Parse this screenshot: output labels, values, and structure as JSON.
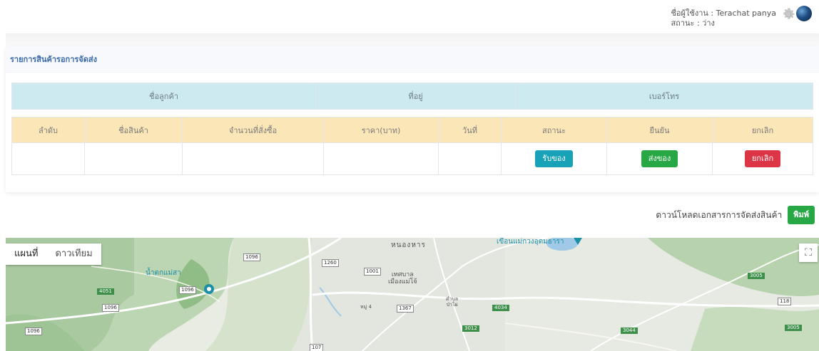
{
  "header": {
    "user_label": "ชื่อผู้ใช้งาน : Terachat panya",
    "status_label": "สถานะ : ว่าง",
    "icons": {
      "settings": "gear-icon",
      "globe": "globe-icon"
    }
  },
  "card": {
    "title": "รายการสินค้ารอการจัดส่ง",
    "customer_table": {
      "headers": [
        "ชื่อลูกค้า",
        "ที่อยู่",
        "เบอร์โทร"
      ]
    },
    "orders_table": {
      "headers": [
        "ลำดับ",
        "ชื่อสินค้า",
        "จำนวนที่สั่งซื้อ",
        "ราคา(บาท)",
        "วันที่",
        "สถานะ",
        "ยืนยัน",
        "ยกเลิก"
      ],
      "row": {
        "receive_button": "รับของ",
        "ship_button": "ส่งของ",
        "cancel_button": "ยกเลิก"
      }
    }
  },
  "download": {
    "label": "ดาวน์โหลดเอกสารการจัดส่งสินค้า",
    "print_button": "พิมพ์"
  },
  "map": {
    "map_type_options": [
      "แผนที่",
      "ดาวเทียม"
    ],
    "selected_map_type": "แผนที่",
    "fullscreen_icon": "fullscreen-icon",
    "labels": {
      "town_north": "หนองหาร",
      "dam": "เขื่อนแม่กวงอุดมธารา",
      "waterfall": "น้ำตกแม่สา",
      "municipality_line1": "เทศบาล",
      "municipality_line2": "เมืองแม่โจ้",
      "subdistrict_line1": "ตำบล",
      "subdistrict_line2": "ป่าไผ่",
      "village": "หมู่ 4"
    },
    "routes": {
      "r1096a": "1096",
      "r1096b": "1096",
      "r1096c": "1096",
      "r1096d": "1096",
      "r1260": "1260",
      "r1001": "1001",
      "r1367": "1367",
      "r107": "107",
      "r118": "118",
      "r4051": "4051",
      "r4034": "4034",
      "r3012": "3012",
      "r3005a": "3005",
      "r3005b": "3005",
      "r3044": "3044"
    }
  }
}
